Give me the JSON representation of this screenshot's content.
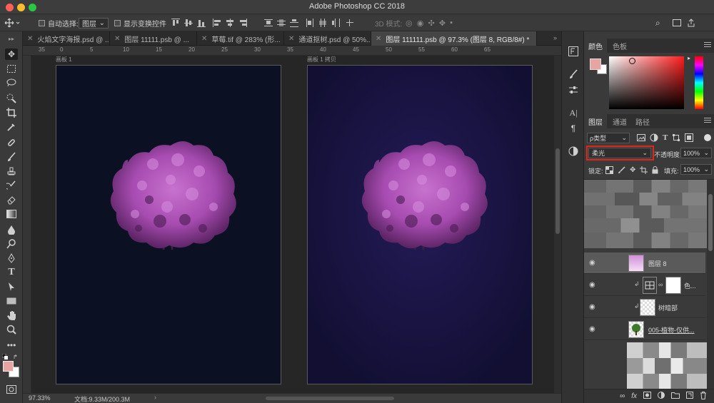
{
  "app": {
    "title": "Adobe Photoshop CC 2018"
  },
  "options": {
    "auto_select_label": "自动选择:",
    "auto_select_value": "图层",
    "show_transform_label": "显示变换控件",
    "mode_3d_label": "3D 模式:"
  },
  "tabs": [
    {
      "label": "火焰文字海报.psd @ ..."
    },
    {
      "label": "图层 11111.psb @ ..."
    },
    {
      "label": "草莓.tif @ 283% (形..."
    },
    {
      "label": "通道抠树.psd @ 50%..."
    },
    {
      "label": "图层 111111.psb @ 97.3% (图层 8, RGB/8#) *"
    }
  ],
  "ruler_ticks": [
    "35",
    "0",
    "5",
    "10",
    "15",
    "20",
    "25",
    "30",
    "35",
    "40",
    "45",
    "50",
    "55",
    "60",
    "65"
  ],
  "artboards": [
    {
      "label": "画板 1"
    },
    {
      "label": "画板 1 拷贝"
    }
  ],
  "status": {
    "zoom": "97.33%",
    "doc": "文档:9.33M/200.3M"
  },
  "color_panel": {
    "tabs": [
      "颜色",
      "色板"
    ],
    "foreground": "#e8a3a3",
    "background": "#ffffff"
  },
  "layers_panel": {
    "tabs": [
      "图层",
      "通道",
      "路径"
    ],
    "filter_label": "ρ类型",
    "blend_mode": "柔光",
    "opacity_label": "不透明度:",
    "opacity_value": "100%",
    "lock_label": "锁定:",
    "fill_label": "填充:",
    "fill_value": "100%",
    "layers": [
      {
        "name": "图层 8"
      },
      {
        "name": "色..."
      },
      {
        "name": "树暗部"
      },
      {
        "name": "005-植物-仅供..."
      }
    ]
  },
  "colors": {
    "tree": "#a64bb0",
    "artboard_left_bg": "#0b1122",
    "artboard_right_bg": "#14103a",
    "highlight_box": "#e0251b"
  }
}
